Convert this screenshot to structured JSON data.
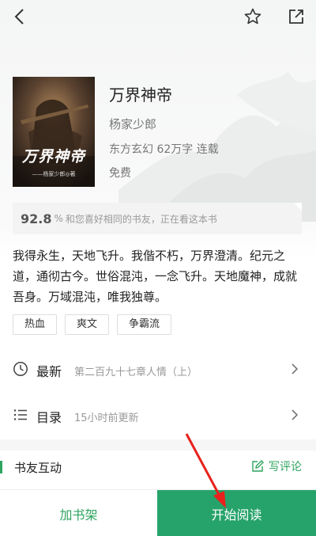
{
  "book": {
    "title": "万界神帝",
    "author": "杨家少郎",
    "meta": "东方玄幻 62万字 连载",
    "price": "免费",
    "cover_title": "万界神帝",
    "cover_credit": "——杨家少郎◎著"
  },
  "match": {
    "percent": "92.8",
    "percent_sign": "%",
    "text": "和您喜好相同的书友，正在看这本书"
  },
  "description": "我得永生，天地飞升。我偕不朽，万界澄清。纪元之道，通彻古今。世俗混沌，一念飞升。天地魔神，成就吾身。万域混沌，唯我独尊。",
  "tags": [
    "热血",
    "爽文",
    "争霸流"
  ],
  "rows": {
    "latest": {
      "label": "最新",
      "sub": "第二百九十七章人情（上）"
    },
    "toc": {
      "label": "目录",
      "sub": "15小时前更新"
    }
  },
  "interaction": {
    "label": "书友互动",
    "comment_label": "写评论"
  },
  "bottom": {
    "shelf_label": "加书架",
    "read_label": "开始阅读"
  },
  "icons": {
    "back": "back-arrow-icon",
    "star": "star-icon",
    "share": "share-icon",
    "latest": "clock-icon",
    "toc": "list-icon",
    "comment": "edit-icon",
    "chevron": "chevron-right-icon"
  },
  "colors": {
    "accent": "#2fa45f",
    "read_button": "#26a36a",
    "annotation_arrow": "#e8211c"
  }
}
